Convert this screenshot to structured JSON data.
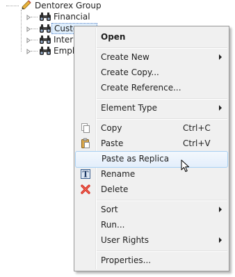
{
  "tree": {
    "root": {
      "label": "Dentorex Group",
      "icon": "pencil-ruler-icon"
    },
    "children": [
      {
        "label": "Financial",
        "icon": "binoculars-icon",
        "selected": false
      },
      {
        "label": "Customer",
        "icon": "binoculars-icon",
        "selected": true
      },
      {
        "label": "Internal",
        "icon": "binoculars-icon",
        "selected": false
      },
      {
        "label": "Employee",
        "icon": "binoculars-icon",
        "selected": false
      }
    ]
  },
  "context_menu": {
    "items": [
      {
        "label": "Open",
        "bold": true
      },
      {
        "label": "Create New",
        "submenu": true
      },
      {
        "label": "Create Copy..."
      },
      {
        "label": "Create Reference..."
      },
      {
        "label": "Element Type",
        "submenu": true
      },
      {
        "label": "Copy",
        "shortcut": "Ctrl+C",
        "icon": "copy-icon"
      },
      {
        "label": "Paste",
        "shortcut": "Ctrl+V",
        "icon": "paste-icon"
      },
      {
        "label": "Paste as Replica",
        "highlighted": true
      },
      {
        "label": "Rename",
        "icon": "rename-icon"
      },
      {
        "label": "Delete",
        "icon": "delete-icon"
      },
      {
        "label": "Sort",
        "submenu": true
      },
      {
        "label": "Run..."
      },
      {
        "label": "User Rights",
        "submenu": true
      },
      {
        "label": "Properties..."
      }
    ]
  },
  "colors": {
    "menu_bg": "#f0f0f0",
    "highlight_border": "#a8d0f2",
    "delete_red": "#d62b1f",
    "selection_bg": "#dfeefc"
  }
}
